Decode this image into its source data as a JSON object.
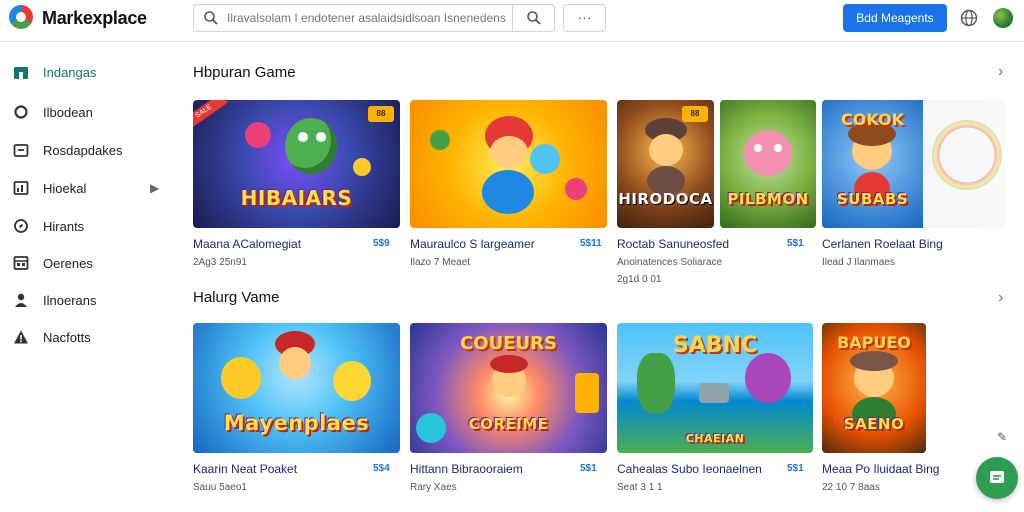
{
  "app": {
    "brand": "Markexplace"
  },
  "search": {
    "placeholder": "Ilravalsolam I endotener asalaidsidlsoan Isnenedens",
    "more_label": "···"
  },
  "header": {
    "primary_button": "Bdd Meagents"
  },
  "sidebar": {
    "items": [
      {
        "label": "Indangas",
        "icon": "home-icon",
        "active": true
      },
      {
        "label": "Ilbodean",
        "icon": "circle-icon"
      },
      {
        "label": "Rosdapdakes",
        "icon": "folder-icon"
      },
      {
        "label": "Hioekal",
        "icon": "chart-icon",
        "has_arrow": true
      },
      {
        "label": "Hirants",
        "icon": "compass-icon"
      },
      {
        "label": "Oerenes",
        "icon": "grid-icon"
      },
      {
        "label": "Ilnoerans",
        "icon": "user-icon"
      },
      {
        "label": "Nacfotts",
        "icon": "warning-icon"
      }
    ]
  },
  "sections": [
    {
      "title": "Hbpuran Game",
      "cards": [
        {
          "thumb_title": "HIBAIARS",
          "name": "Maana ACalomegiat",
          "price": "5$9",
          "sub": "2Ag3 25n91",
          "badge": "88"
        },
        {
          "thumb_title": "",
          "name": "Mauraulco S largeamer",
          "price": "5$11",
          "sub": "Ilazo 7 Meaet"
        },
        {
          "thumb_title": "HIRODOCA",
          "name": "Roctab Sanuneosfed",
          "price": "5$1",
          "sub": "Anoinatences Soliarace",
          "sub2": "2g1d 0 01",
          "badge": "88"
        },
        {
          "thumb_title": "PILBMON",
          "name": ""
        },
        {
          "thumb_title": "SUBABS",
          "top_title": "COKOK",
          "name": "Cerlanen Roelaat Bing",
          "sub": "Ilead J Ilanmaes"
        }
      ]
    },
    {
      "title": "Halurg Vame",
      "cards": [
        {
          "thumb_title": "Mayenplaes",
          "name": "Kaarin Neat Poaket",
          "price": "5$4",
          "sub": "Sauu 5aeo1"
        },
        {
          "thumb_title": "COREIME",
          "top_title": "COUEURS",
          "name": "Hittann Bibraooraiem",
          "price": "5$1",
          "sub": "Rary Xaes"
        },
        {
          "thumb_title": "CHAEIAN",
          "top_title": "SABNC",
          "name": "Cahealas Subo Ieonaelnen",
          "price": "5$1",
          "sub": "Seat 3 1 1"
        },
        {
          "thumb_title": "SAENO",
          "top_title": "BAPUEO",
          "name": "Meaa Po Iluidaat Bing",
          "sub": "22 10 7 8aas"
        }
      ]
    }
  ],
  "colors": {
    "accent": "#1a73e8",
    "active_nav": "#0f766e",
    "fab": "#2e9d4f"
  }
}
